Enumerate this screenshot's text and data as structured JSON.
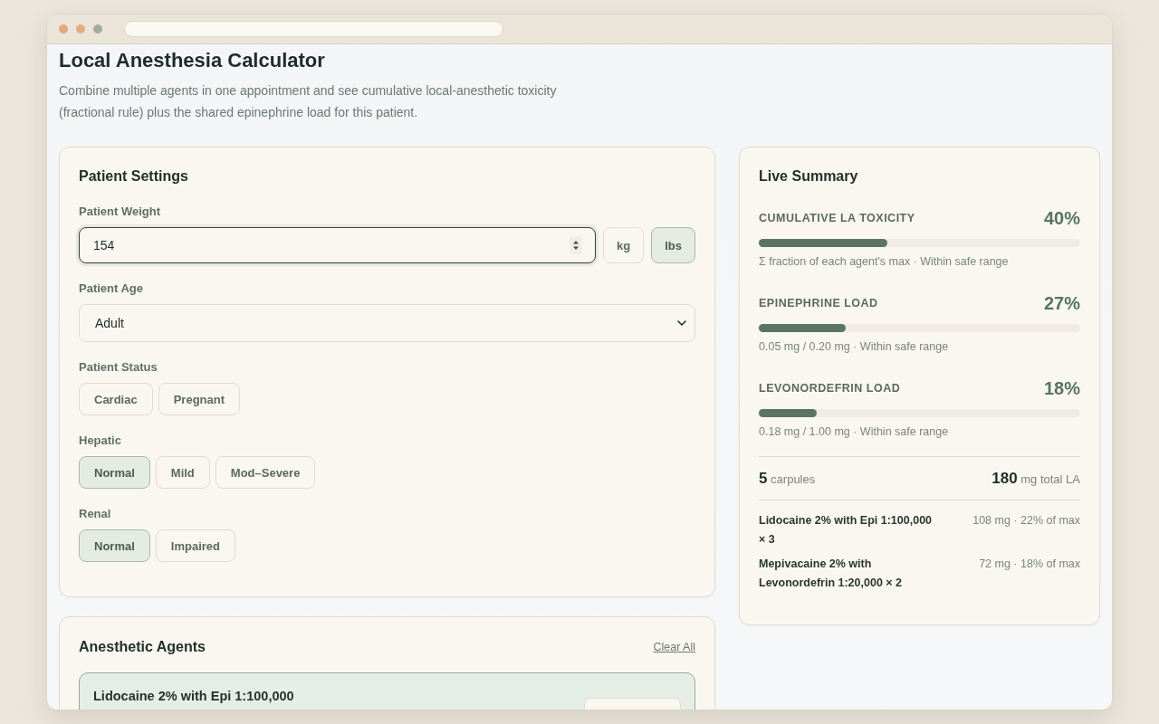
{
  "page": {
    "title": "Local Anesthesia Calculator",
    "description": "Combine multiple agents in one appointment and see cumulative local-anesthetic toxicity (fractional rule) plus the shared epinephrine load for this patient."
  },
  "patient_settings": {
    "title": "Patient Settings",
    "weight": {
      "label": "Patient Weight",
      "value": "154",
      "focused": true,
      "units": [
        {
          "label": "kg",
          "selected": false
        },
        {
          "label": "lbs",
          "selected": true
        }
      ]
    },
    "age": {
      "label": "Patient Age",
      "value": "Adult"
    },
    "groups": [
      {
        "label": "Patient Status",
        "options": [
          {
            "label": "Cardiac",
            "selected": false
          },
          {
            "label": "Pregnant",
            "selected": false
          }
        ]
      },
      {
        "label": "Hepatic",
        "options": [
          {
            "label": "Normal",
            "selected": true
          },
          {
            "label": "Mild",
            "selected": false
          },
          {
            "label": "Mod–Severe",
            "selected": false
          }
        ]
      },
      {
        "label": "Renal",
        "options": [
          {
            "label": "Normal",
            "selected": true
          },
          {
            "label": "Impaired",
            "selected": false
          }
        ]
      }
    ]
  },
  "summary": {
    "title": "Live Summary",
    "metrics": [
      {
        "label": "CUMULATIVE LA TOXICITY",
        "percent": "40%",
        "level": 0.4,
        "caption": "Σ fraction of each agent's max · Within safe range"
      },
      {
        "label": "EPINEPHRINE LOAD",
        "percent": "27%",
        "level": 0.27,
        "caption": "0.05 mg / 0.20 mg · Within safe range"
      },
      {
        "label": "LEVONORDEFRIN LOAD",
        "percent": "18%",
        "level": 0.18,
        "caption": "0.18 mg / 1.00 mg · Within safe range"
      }
    ],
    "totals": [
      {
        "value": "5",
        "unit": "carpules"
      },
      {
        "value": "180",
        "unit": "mg total LA"
      }
    ],
    "breakdown": [
      {
        "name": "Lidocaine 2% with Epi 1:100,000 × 3",
        "detail": "108 mg · 22% of max"
      },
      {
        "name": "Mepivacaine 2% with Levonordefrin 1:20,000 × 2",
        "detail": "72 mg · 18% of max"
      }
    ]
  },
  "agents_panel": {
    "title": "Anesthetic Agents",
    "clear_label": "Clear All",
    "agents": [
      {
        "name": "Lidocaine 2% with Epi 1:100,000"
      }
    ]
  }
}
